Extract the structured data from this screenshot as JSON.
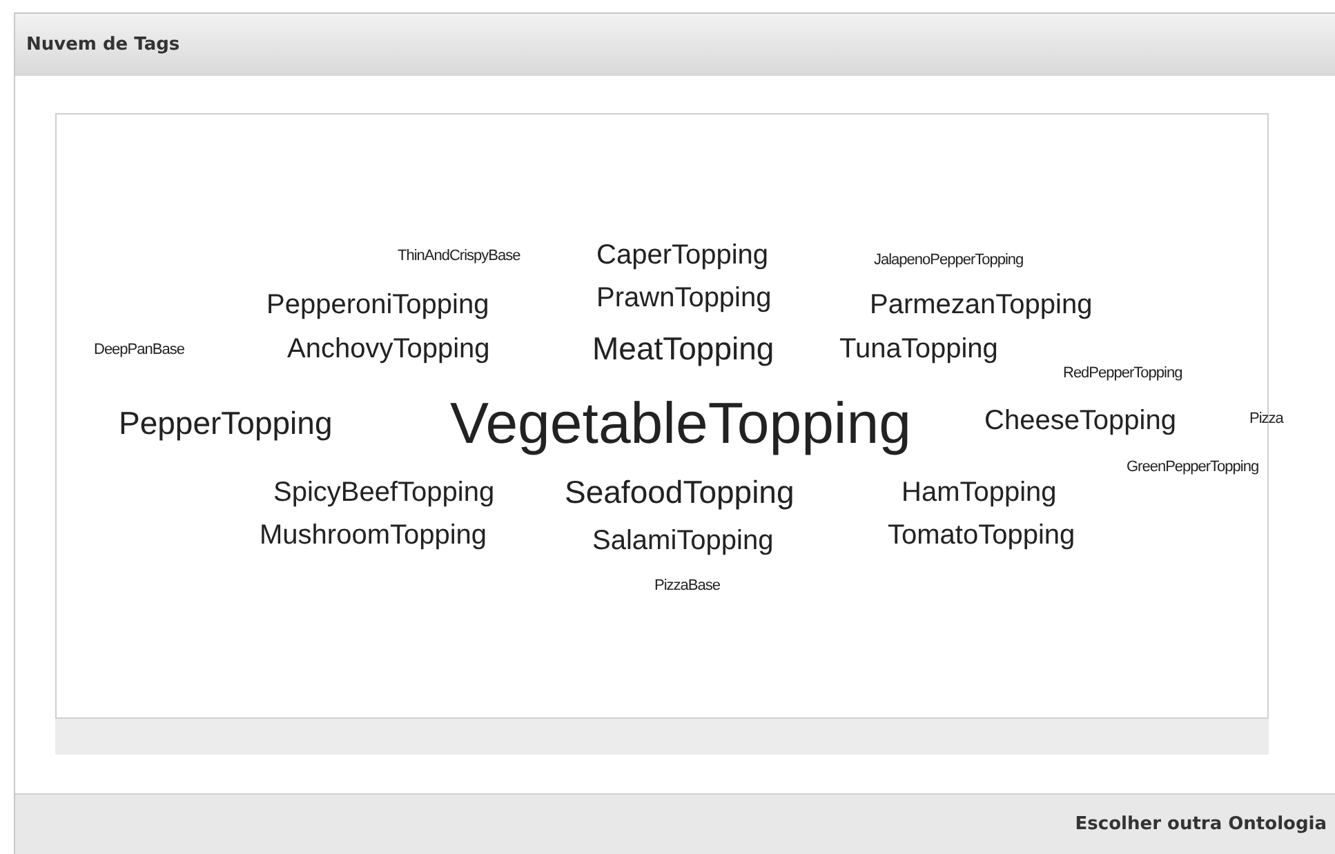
{
  "panel": {
    "title": "Nuvem de Tags"
  },
  "tag_cloud": {
    "tags": [
      {
        "text": "ThinAndCrispyBase",
        "kind": "s"
      },
      {
        "text": "CaperTopping",
        "kind": "m"
      },
      {
        "text": "JalapenoPepperTopping",
        "kind": "s"
      },
      {
        "text": "PepperoniTopping",
        "kind": "m"
      },
      {
        "text": "PrawnTopping",
        "kind": "m"
      },
      {
        "text": "ParmezanTopping",
        "kind": "m"
      },
      {
        "text": "DeepPanBase",
        "kind": "s"
      },
      {
        "text": "AnchovyTopping",
        "kind": "m"
      },
      {
        "text": "MeatTopping",
        "kind": "l"
      },
      {
        "text": "TunaTopping",
        "kind": "m"
      },
      {
        "text": "RedPepperTopping",
        "kind": "s"
      },
      {
        "text": "PepperTopping",
        "kind": "l"
      },
      {
        "text": "VegetableTopping",
        "kind": "xl"
      },
      {
        "text": "CheeseTopping",
        "kind": "m"
      },
      {
        "text": "Pizza",
        "kind": "s"
      },
      {
        "text": "GreenPepperTopping",
        "kind": "s"
      },
      {
        "text": "SpicyBeefTopping",
        "kind": "m"
      },
      {
        "text": "SeafoodTopping",
        "kind": "l"
      },
      {
        "text": "HamTopping",
        "kind": "m"
      },
      {
        "text": "MushroomTopping",
        "kind": "m"
      },
      {
        "text": "SalamiTopping",
        "kind": "m"
      },
      {
        "text": "TomatoTopping",
        "kind": "m"
      },
      {
        "text": "PizzaBase",
        "kind": "s"
      }
    ]
  },
  "footer": {
    "link": "Escolher outra Ontologia"
  }
}
